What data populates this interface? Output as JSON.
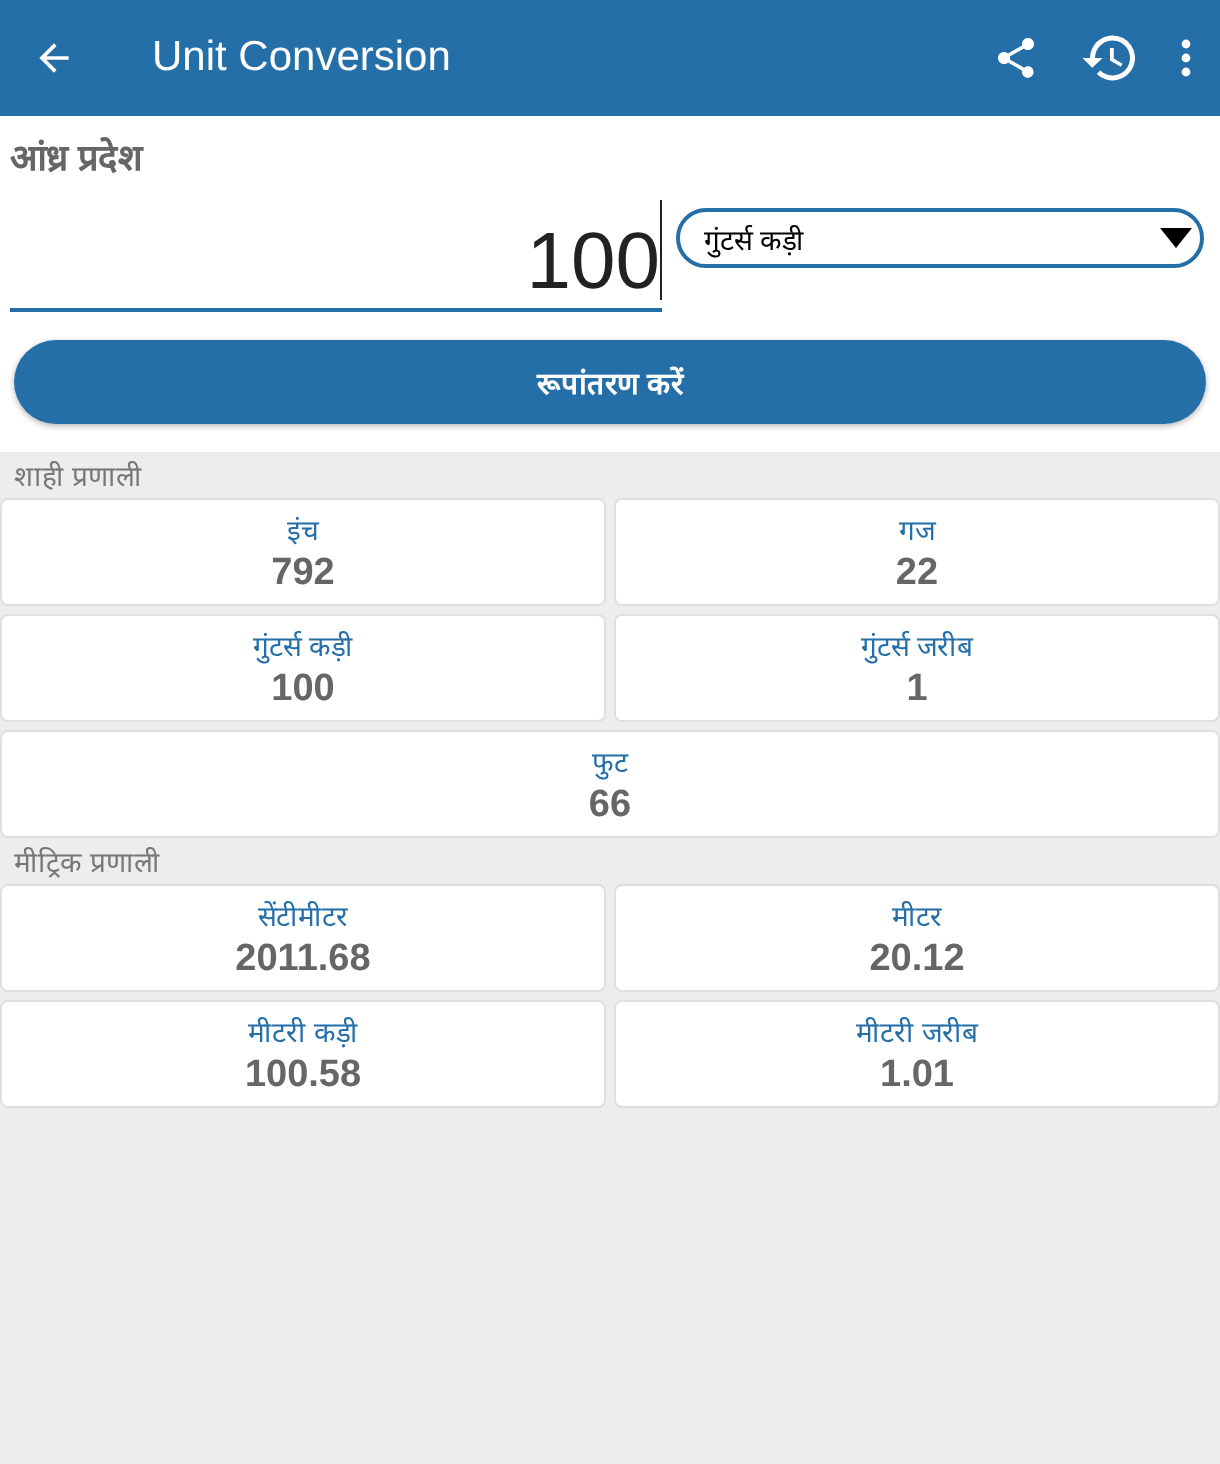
{
  "app_bar": {
    "title": "Unit Conversion"
  },
  "region": "आंध्र प्रदेश",
  "input": {
    "value": "100"
  },
  "unit_select": {
    "value": "गुंटर्स कड़ी"
  },
  "convert_button": "रूपांतरण करें",
  "sections": [
    {
      "title": "शाही प्रणाली",
      "results": [
        {
          "unit": "इंच",
          "value": "792"
        },
        {
          "unit": "गज",
          "value": "22"
        },
        {
          "unit": "गुंटर्स कड़ी",
          "value": "100"
        },
        {
          "unit": "गुंटर्स जरीब",
          "value": "1"
        },
        {
          "unit": "फुट",
          "value": "66"
        }
      ]
    },
    {
      "title": "मीट्रिक प्रणाली",
      "results": [
        {
          "unit": "सेंटीमीटर",
          "value": "2011.68"
        },
        {
          "unit": "मीटर",
          "value": "20.12"
        },
        {
          "unit": "मीटरी कड़ी",
          "value": "100.58"
        },
        {
          "unit": "मीटरी जरीब",
          "value": "1.01"
        }
      ]
    }
  ]
}
